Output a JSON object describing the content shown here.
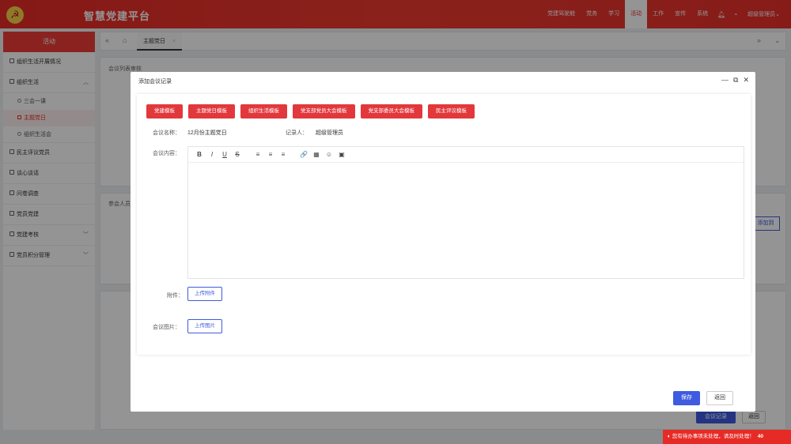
{
  "header": {
    "logo_glyph": "☭",
    "app_title": "智慧党建平台",
    "nav": [
      "党建驾驶舱",
      "党务",
      "学习",
      "活动",
      "工作",
      "宣传",
      "系统"
    ],
    "active_nav": "活动",
    "user": "超级管理员"
  },
  "sidebar": {
    "header": "活动",
    "items": [
      {
        "label": "组织生活开展情况"
      },
      {
        "label": "组织生活",
        "expanded": true,
        "children": [
          "三会一课",
          "主题党日",
          "组织生活会"
        ]
      },
      {
        "label": "民主评议党员"
      },
      {
        "label": "谈心谈话"
      },
      {
        "label": "问卷调查"
      },
      {
        "label": "党员党建"
      },
      {
        "label": "党建考核",
        "has_children": true
      },
      {
        "label": "党员积分管理",
        "has_children": true
      }
    ],
    "active_child": "主题党日"
  },
  "tabs": {
    "items": [
      {
        "label": "主题党日"
      }
    ]
  },
  "background": {
    "panel1_title": "会议列表审核",
    "panel2_title": "参会人员",
    "right_btn": "添加到",
    "bottom_primary": "会议记录",
    "bottom_secondary": "返回"
  },
  "modal": {
    "title": "添加会议记录",
    "templates": [
      "党建模板",
      "主题党日模板",
      "组织生活模板",
      "党支部党员大会模板",
      "党支部委员大会模板",
      "民主评议模板"
    ],
    "meeting_name_label": "会议名称：",
    "meeting_name_value": "12月份主题党日",
    "recorder_label": "记录人：",
    "recorder_value": "超级管理员",
    "content_label": "会议内容：",
    "editor_tools": [
      "B",
      "I",
      "U",
      "S",
      "≡",
      "≡",
      "≡",
      "🔗",
      "▦",
      "☺",
      "▣"
    ],
    "attachment_label": "附件：",
    "attachment_btn": "上传附件",
    "photo_label": "会议图片：",
    "photo_btn": "上传图片",
    "save": "保存",
    "back": "返回"
  },
  "notification": {
    "text": "您有待办事项未处理，请及时处理！",
    "count": "40"
  }
}
